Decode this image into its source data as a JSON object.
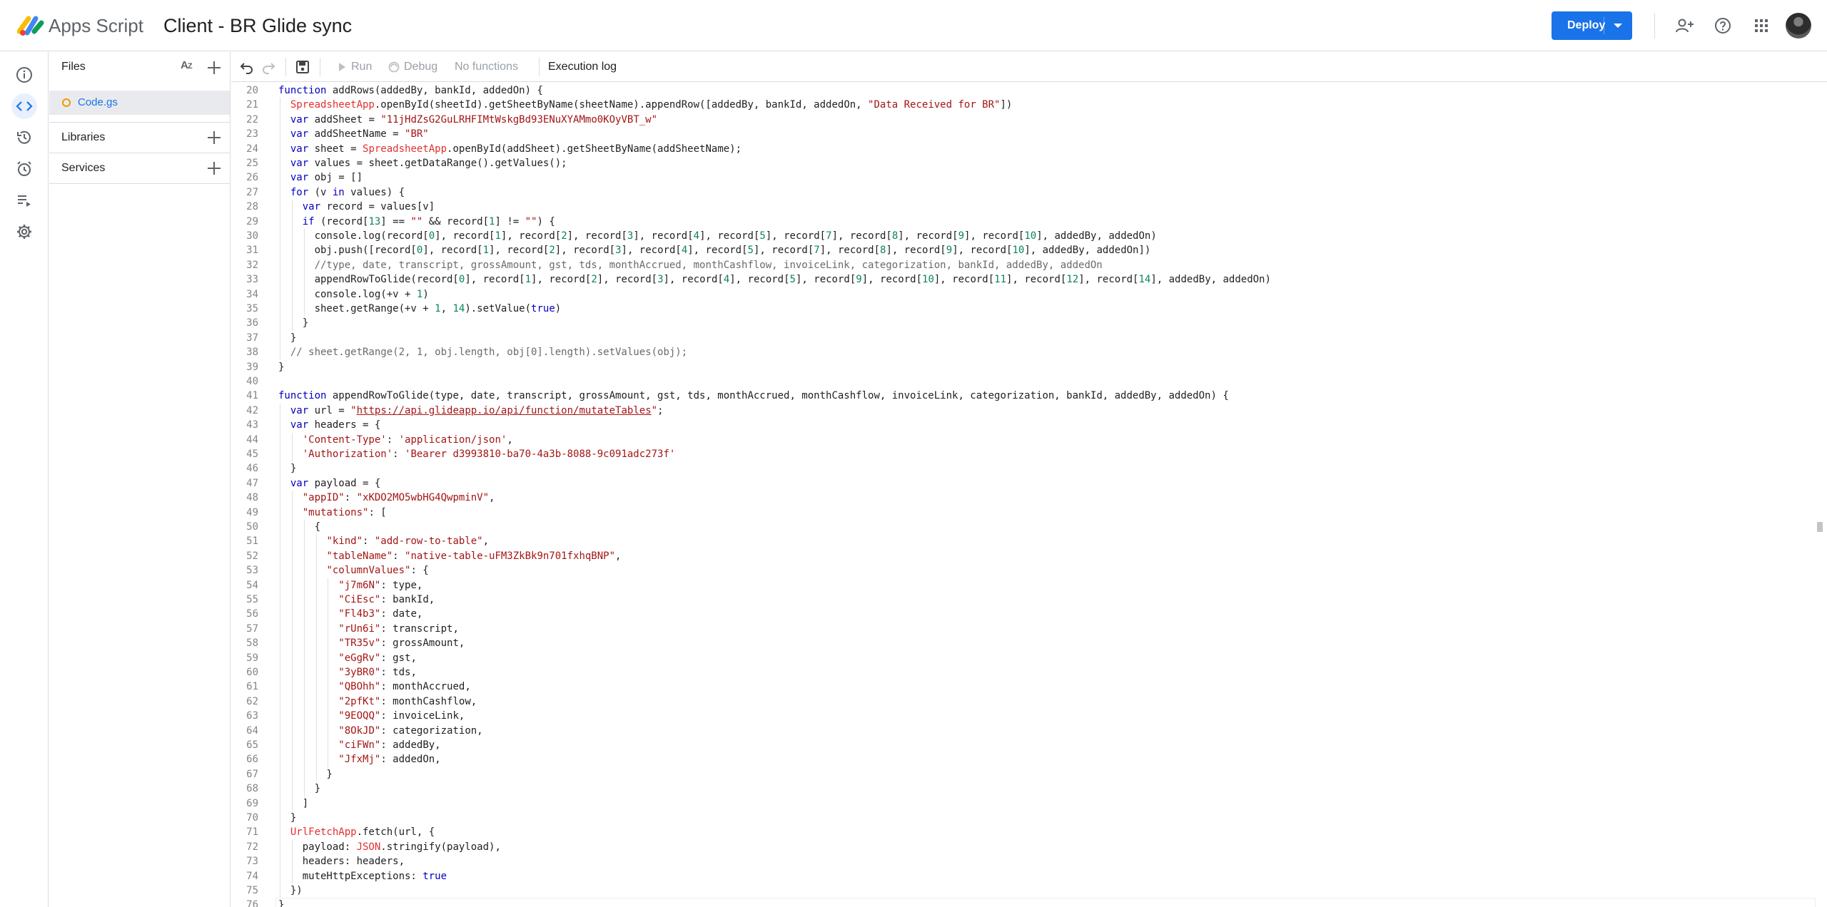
{
  "header": {
    "product_name": "Apps Script",
    "project_title": "Client - BR Glide sync",
    "deploy_label": "Deploy"
  },
  "rail": [
    "overview-icon",
    "editor-icon",
    "triggers-history-icon",
    "triggers-icon",
    "executions-icon",
    "settings-icon"
  ],
  "files_panel": {
    "title": "Files",
    "file_name": "Code.gs",
    "libraries_label": "Libraries",
    "services_label": "Services"
  },
  "toolbar": {
    "run_label": "Run",
    "debug_label": "Debug",
    "function_select": "No functions",
    "execution_log_label": "Execution log"
  },
  "colors": {
    "accent": "#1a73e8",
    "keyword": "#0000c0",
    "string": "#a31515",
    "number": "#098658"
  },
  "code": {
    "lines": [
      {
        "n": "20",
        "text": "function addRows(addedBy, bankId, addedOn) {"
      },
      {
        "n": "21",
        "text": "  SpreadsheetApp.openById(sheetId).getSheetByName(sheetName).appendRow([addedBy, bankId, addedOn, \"Data Received for BR\"])"
      },
      {
        "n": "22",
        "text": "  var addSheet = \"11jHdZsG2GuLRHFIMtWskgBd93ENuXYAMmo0KOyVBT_w\""
      },
      {
        "n": "23",
        "text": "  var addSheetName = \"BR\""
      },
      {
        "n": "24",
        "text": "  var sheet = SpreadsheetApp.openById(addSheet).getSheetByName(addSheetName);"
      },
      {
        "n": "25",
        "text": "  var values = sheet.getDataRange().getValues();"
      },
      {
        "n": "26",
        "text": "  var obj = []"
      },
      {
        "n": "27",
        "text": "  for (v in values) {"
      },
      {
        "n": "28",
        "text": "    var record = values[v]"
      },
      {
        "n": "29",
        "text": "    if (record[13] == \"\" && record[1] != \"\") {"
      },
      {
        "n": "30",
        "text": "      console.log(record[0], record[1], record[2], record[3], record[4], record[5], record[7], record[8], record[9], record[10], addedBy, addedOn)"
      },
      {
        "n": "31",
        "text": "      obj.push([record[0], record[1], record[2], record[3], record[4], record[5], record[7], record[8], record[9], record[10], addedBy, addedOn])"
      },
      {
        "n": "32",
        "text": "      //type, date, transcript, grossAmount, gst, tds, monthAccrued, monthCashflow, invoiceLink, categorization, bankId, addedBy, addedOn"
      },
      {
        "n": "33",
        "text": "      appendRowToGlide(record[0], record[1], record[2], record[3], record[4], record[5], record[9], record[10], record[11], record[12], record[14], addedBy, addedOn)"
      },
      {
        "n": "34",
        "text": "      console.log(+v + 1)"
      },
      {
        "n": "35",
        "text": "      sheet.getRange(+v + 1, 14).setValue(true)"
      },
      {
        "n": "36",
        "text": "    }"
      },
      {
        "n": "37",
        "text": "  }"
      },
      {
        "n": "38",
        "text": "  // sheet.getRange(2, 1, obj.length, obj[0].length).setValues(obj);"
      },
      {
        "n": "39",
        "text": "}"
      },
      {
        "n": "40",
        "text": ""
      },
      {
        "n": "41",
        "text": "function appendRowToGlide(type, date, transcript, grossAmount, gst, tds, monthAccrued, monthCashflow, invoiceLink, categorization, bankId, addedBy, addedOn) {"
      },
      {
        "n": "42",
        "text": "  var url = \"https://api.glideapp.io/api/function/mutateTables\";"
      },
      {
        "n": "43",
        "text": "  var headers = {"
      },
      {
        "n": "44",
        "text": "    'Content-Type': 'application/json',"
      },
      {
        "n": "45",
        "text": "    'Authorization': 'Bearer d3993810-ba70-4a3b-8088-9c091adc273f'"
      },
      {
        "n": "46",
        "text": "  }"
      },
      {
        "n": "47",
        "text": "  var payload = {"
      },
      {
        "n": "48",
        "text": "    \"appID\": \"xKDO2MO5wbHG4QwpminV\","
      },
      {
        "n": "49",
        "text": "    \"mutations\": ["
      },
      {
        "n": "50",
        "text": "      {"
      },
      {
        "n": "51",
        "text": "        \"kind\": \"add-row-to-table\","
      },
      {
        "n": "52",
        "text": "        \"tableName\": \"native-table-uFM3ZkBk9n701fxhqBNP\","
      },
      {
        "n": "53",
        "text": "        \"columnValues\": {"
      },
      {
        "n": "54",
        "text": "          \"j7m6N\": type,"
      },
      {
        "n": "55",
        "text": "          \"CiEsc\": bankId,"
      },
      {
        "n": "56",
        "text": "          \"Fl4b3\": date,"
      },
      {
        "n": "57",
        "text": "          \"rUn6i\": transcript,"
      },
      {
        "n": "58",
        "text": "          \"TR35v\": grossAmount,"
      },
      {
        "n": "59",
        "text": "          \"eGgRv\": gst,"
      },
      {
        "n": "60",
        "text": "          \"3yBR0\": tds,"
      },
      {
        "n": "61",
        "text": "          \"QBOhh\": monthAccrued,"
      },
      {
        "n": "62",
        "text": "          \"2pfKt\": monthCashflow,"
      },
      {
        "n": "63",
        "text": "          \"9EOQQ\": invoiceLink,"
      },
      {
        "n": "64",
        "text": "          \"8OkJD\": categorization,"
      },
      {
        "n": "65",
        "text": "          \"ciFWn\": addedBy,"
      },
      {
        "n": "66",
        "text": "          \"JfxMj\": addedOn,"
      },
      {
        "n": "67",
        "text": "        }"
      },
      {
        "n": "68",
        "text": "      }"
      },
      {
        "n": "69",
        "text": "    ]"
      },
      {
        "n": "70",
        "text": "  }"
      },
      {
        "n": "71",
        "text": "  UrlFetchApp.fetch(url, {"
      },
      {
        "n": "72",
        "text": "    payload: JSON.stringify(payload),"
      },
      {
        "n": "73",
        "text": "    headers: headers,"
      },
      {
        "n": "74",
        "text": "    muteHttpExceptions: true"
      },
      {
        "n": "75",
        "text": "  })"
      },
      {
        "n": "76",
        "text": "}"
      }
    ]
  }
}
